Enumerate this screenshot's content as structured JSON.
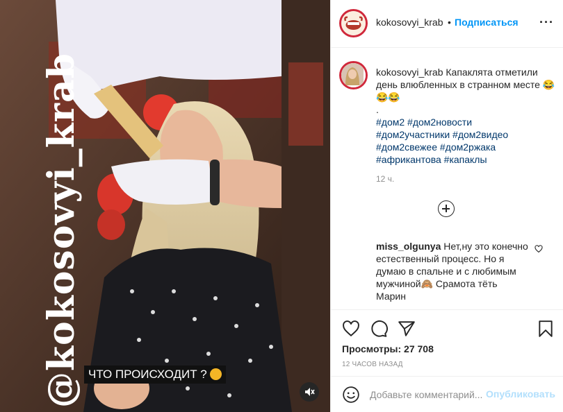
{
  "post": {
    "username": "kokosovyi_krab",
    "follow_label": "Подписаться",
    "caption_text": "Капаклята отметили день влюбленных в странном месте 😂😂😂",
    "caption_dot": ".",
    "hashtags": [
      "#дом2",
      "#дом2новости",
      "#дом2участники",
      "#дом2видео",
      "#дом2свежее",
      "#дом2ржака",
      "#африкантова",
      "#капаклы"
    ],
    "time_ago": "12 ч.",
    "views_label": "Просмотры: 27 708",
    "date_label": "12 ЧАСОВ НАЗАД"
  },
  "media": {
    "watermark": "@kokosovyi_krab",
    "subtitle": "ЧТО ПРОИСХОДИТ ?"
  },
  "comments": [
    {
      "username": "miss_olgunya",
      "text": "Нет,ну это конечно естественный процесс. Но я думаю в спальне и с любимым мужчиной🙈 Срамота тёть Марин"
    }
  ],
  "comment_form": {
    "placeholder": "Добавьте комментарий...",
    "submit_label": "Опубликовать"
  },
  "icons": {
    "more": "more-options-icon",
    "like": "heart-icon",
    "comment": "comment-icon",
    "share": "share-icon",
    "save": "bookmark-icon",
    "emoji": "emoji-icon",
    "mute": "sound-off-icon",
    "load_more": "plus-circle-icon"
  },
  "colors": {
    "link_blue": "#0095f6",
    "hashtag_blue": "#00376b",
    "muted_gray": "#8e8e8e",
    "disabled_blue": "#b2dffc"
  }
}
